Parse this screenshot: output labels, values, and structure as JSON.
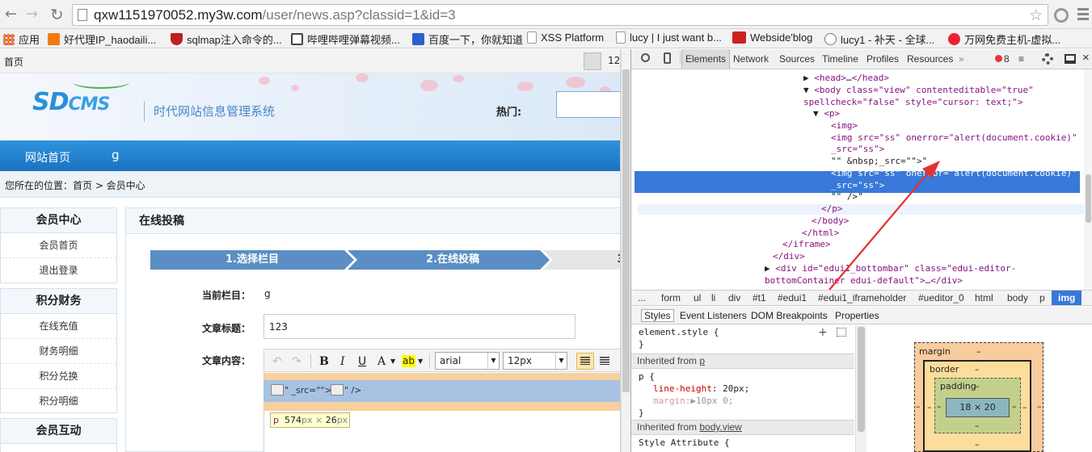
{
  "browser": {
    "url_host": "qxw1151970052.my3w.com",
    "url_path": "/user/news.asp?classid=1&id=3",
    "bookmarks": [
      "应用",
      "好代理IP_haodaili...",
      "sqlmap注入命令的...",
      "哔哩哔哩弹幕视频...",
      "百度一下，你就知道",
      "XSS Platform",
      "lucy | I just want b...",
      "Webside'blog",
      "lucy1 - 补天 - 全球...",
      "万网免费主机-虚拟..."
    ]
  },
  "site": {
    "top_home": "首页",
    "top_count": "12",
    "logo_sd": "SD",
    "logo_cms": "CMS",
    "subtitle": "时代网站信息管理系统",
    "hot_label": "热门:",
    "nav": [
      "网站首页",
      "g"
    ],
    "breadcrumb": "您所在的位置：首页 > 会员中心"
  },
  "sidebar": [
    {
      "title": "会员中心",
      "items": [
        "会员首页",
        "退出登录"
      ]
    },
    {
      "title": "积分财务",
      "items": [
        "在线充值",
        "财务明细",
        "积分兑换",
        "积分明细"
      ]
    },
    {
      "title": "会员互动",
      "items": []
    }
  ],
  "content": {
    "title": "在线投稿",
    "steps": [
      "1.选择栏目",
      "2.在线投稿",
      "3"
    ],
    "current_column_label": "当前栏目：",
    "current_column_value": "g",
    "title_label": "文章标题：",
    "title_value": "123",
    "content_label": "文章内容：",
    "editor": {
      "undo": "↶",
      "redo": "↷",
      "bold": "B",
      "italic": "I",
      "underline": "U",
      "fontcolor": "A",
      "highlight": "ab",
      "font": "arial",
      "size": "12px",
      "body_text": "\" _src=\"\">",
      "body_text2": "\" />",
      "tooltip_tag": "p",
      "tooltip_w": "574",
      "tooltip_h": "26",
      "tooltip_unit": "px",
      "tooltip_x": "×"
    }
  },
  "devtools": {
    "tabs": [
      "Elements",
      "Network",
      "Sources",
      "Timeline",
      "Profiles",
      "Resources"
    ],
    "more": "»",
    "error_count": "8",
    "code_lines": [
      [
        "▶ ",
        "<head>",
        "…",
        "</head>",
        ""
      ],
      [
        "▼ ",
        "<body class=\"view\" contenteditable=\"true\"",
        "",
        "",
        ""
      ],
      [
        "",
        "spellcheck=\"false\" style=\"cursor: text;\">",
        "",
        "",
        ""
      ],
      [
        "▼ ",
        "<p>",
        "",
        "",
        ""
      ],
      [
        "",
        "<img>",
        "",
        "",
        ""
      ],
      [
        "",
        "<img src=\"ss\" onerror=\"alert(document.cookie)\"",
        "",
        "",
        ""
      ],
      [
        "",
        "_src=\"ss\">",
        "",
        "",
        ""
      ],
      [
        "",
        "\"\" &nbsp;_src=\"\">\"",
        "",
        "",
        ""
      ],
      [
        "",
        "<img src=\"ss\" onerror=\"alert(document.cookie)\"",
        "",
        "",
        ""
      ],
      [
        "",
        "_src=\"ss\">",
        "",
        "",
        ""
      ],
      [
        "",
        "\"\" />\"",
        "",
        "",
        ""
      ],
      [
        "",
        "</p>",
        "",
        "",
        ""
      ],
      [
        "",
        "</body>",
        "",
        "",
        ""
      ],
      [
        "",
        "</html>",
        "",
        "",
        ""
      ],
      [
        "",
        "</iframe>",
        "",
        "",
        ""
      ],
      [
        "",
        "</div>",
        "",
        "",
        ""
      ],
      [
        "▶ ",
        "<div id=\"edui1_bottombar\" class=\"edui-editor-",
        "",
        "",
        ""
      ],
      [
        "",
        "bottomContainer edui-default\">…</div>",
        "",
        "",
        ""
      ]
    ],
    "crumbs": [
      "...",
      "form",
      "ul",
      "li",
      "div",
      "#t1",
      "#edui1",
      "#edui1_iframeholder",
      "#ueditor_0",
      "html",
      "body",
      "p",
      "img"
    ],
    "subtabs": [
      "Styles",
      "Event Listeners",
      "DOM Breakpoints",
      "Properties"
    ],
    "styles": {
      "element_style": "element.style {",
      "close": "}",
      "inherited_p": "Inherited from ",
      "inherited_p_link": "p",
      "p_rule": "p {",
      "line_height_prop": "line-height",
      "line_height_val": "20px;",
      "margin_prop": "margin",
      "margin_val": "▶10px 0;",
      "inherited_body": "Inherited from ",
      "inherited_body_link": "body.view",
      "style_attr": "Style Attribute {"
    },
    "boxmodel": {
      "margin": "margin",
      "border": "border",
      "padding": "padding",
      "content": "18 × 20",
      "dash": "–"
    }
  }
}
